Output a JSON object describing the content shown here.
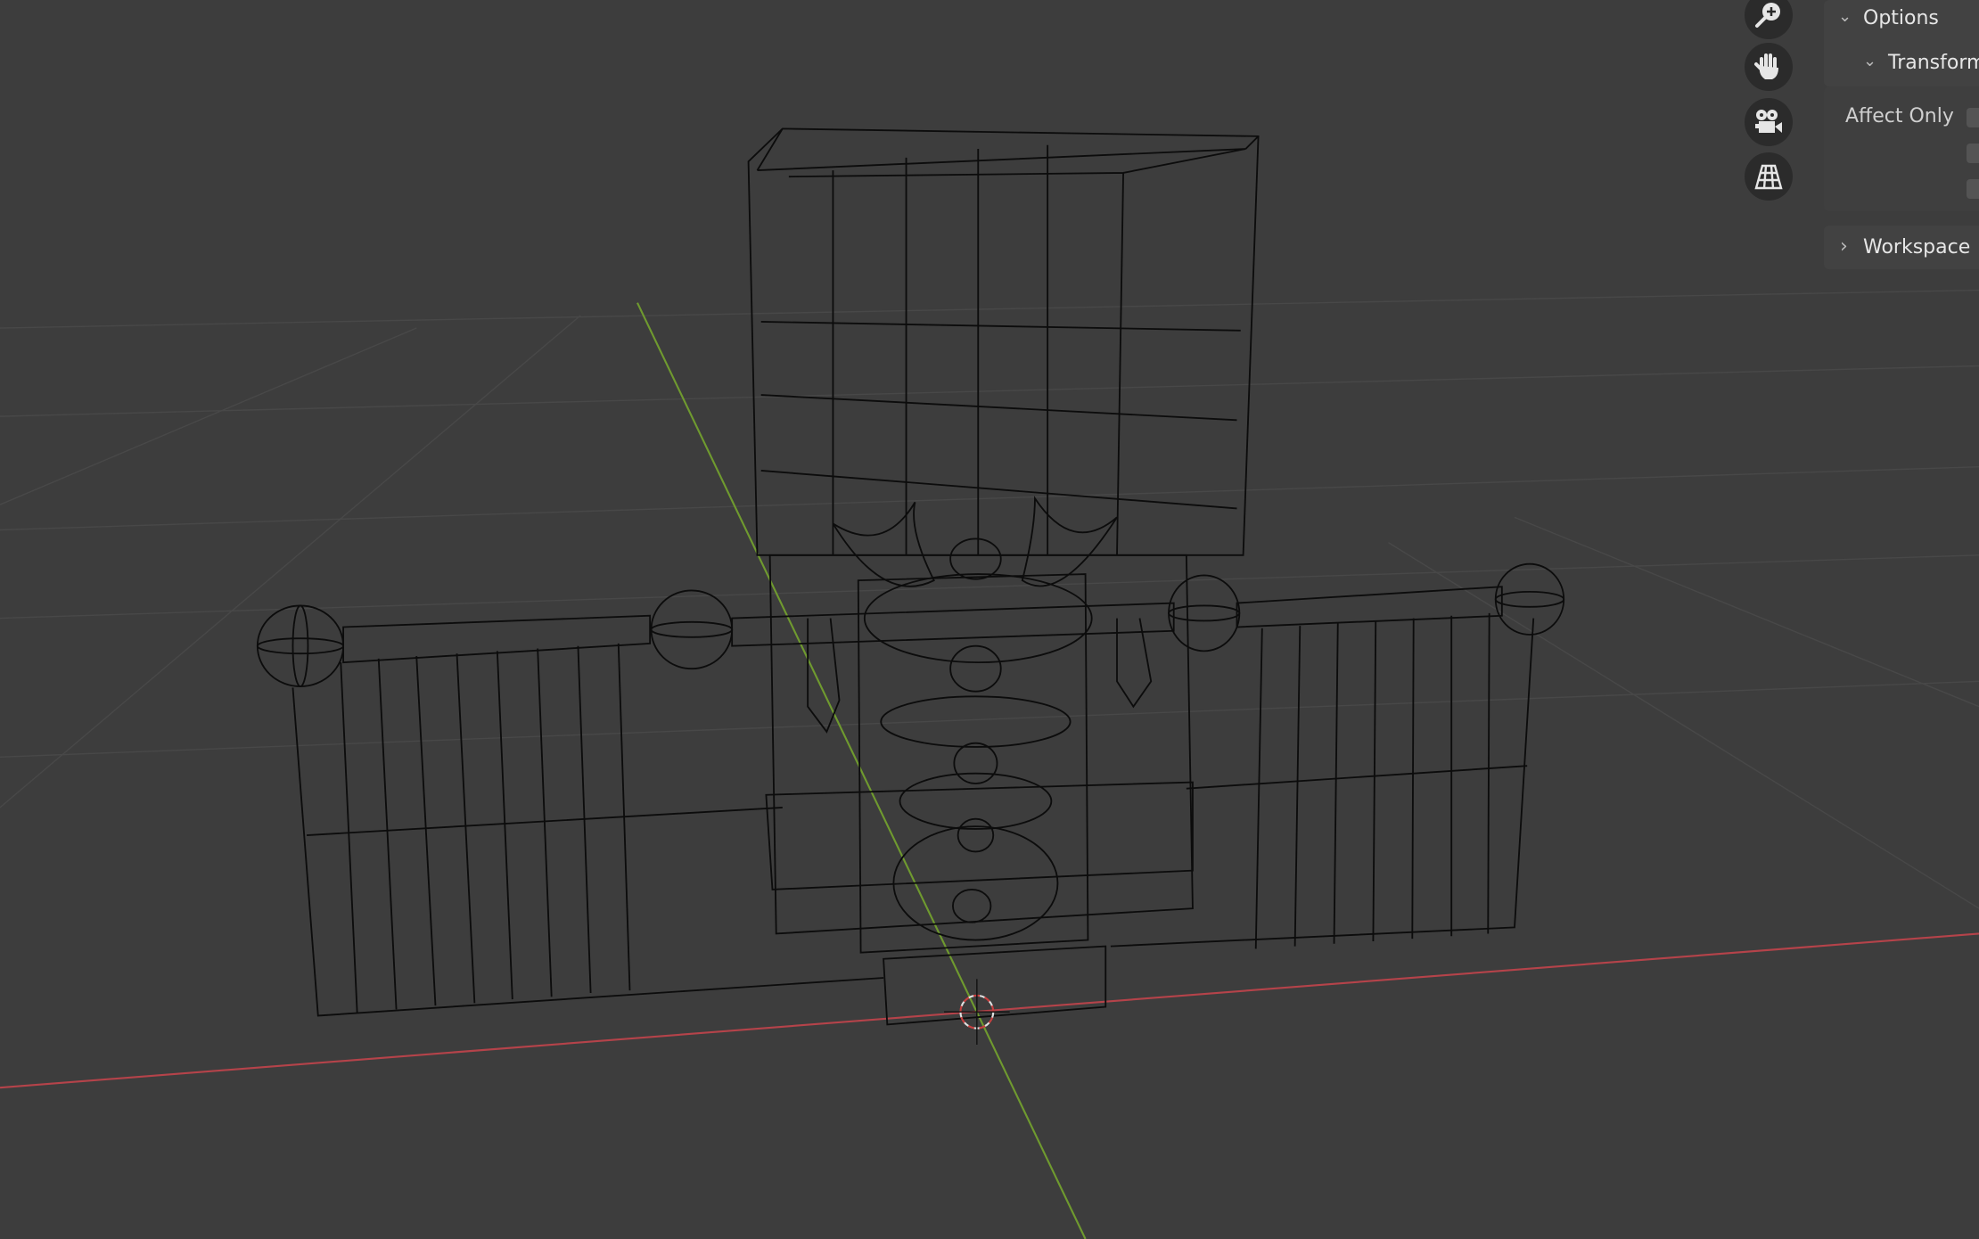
{
  "viewport": {
    "nav_gizmo": [
      {
        "icon": "zoom-icon"
      },
      {
        "icon": "hand-pan-icon"
      },
      {
        "icon": "camera-icon"
      },
      {
        "icon": "grid-perspective-icon"
      }
    ],
    "colors": {
      "background": "#3d3d3d",
      "x_axis": "#b5434a",
      "y_axis": "#6f9a2f",
      "wire": "#0c0c0c",
      "grid": "#4a4a4a"
    }
  },
  "sidebar": {
    "options_label": "Options",
    "transform_label": "Transform",
    "affect_only_label": "Affect Only",
    "checkboxes": [
      false,
      false,
      false
    ],
    "workspace_label": "Workspace"
  }
}
